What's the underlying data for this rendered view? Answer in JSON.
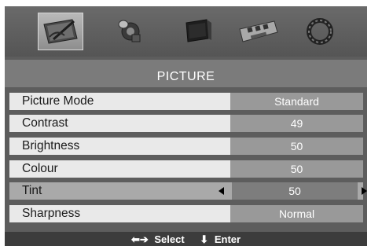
{
  "menu": {
    "tabs": [
      {
        "icon": "picture-icon",
        "selected": true
      },
      {
        "icon": "sound-icon",
        "selected": false
      },
      {
        "icon": "channel-icon",
        "selected": false
      },
      {
        "icon": "features-icon",
        "selected": false
      },
      {
        "icon": "setup-icon",
        "selected": false
      }
    ],
    "title": "PICTURE",
    "items": [
      {
        "label": "Picture Mode",
        "value": "Standard"
      },
      {
        "label": "Contrast",
        "value": "49"
      },
      {
        "label": "Brightness",
        "value": "50"
      },
      {
        "label": "Colour",
        "value": "50"
      },
      {
        "label": "Tint",
        "value": "50",
        "active": true
      },
      {
        "label": "Sharpness",
        "value": "Normal"
      }
    ]
  },
  "footer": {
    "select_icon": "left-right-arrows-icon",
    "select_label": "Select",
    "enter_icon": "down-arrow-icon",
    "enter_label": "Enter"
  },
  "colors": {
    "panel": "#5d5d5d",
    "row": "#e9e9e9",
    "active_row": "#a9a9a9",
    "value_box": "#999999"
  }
}
